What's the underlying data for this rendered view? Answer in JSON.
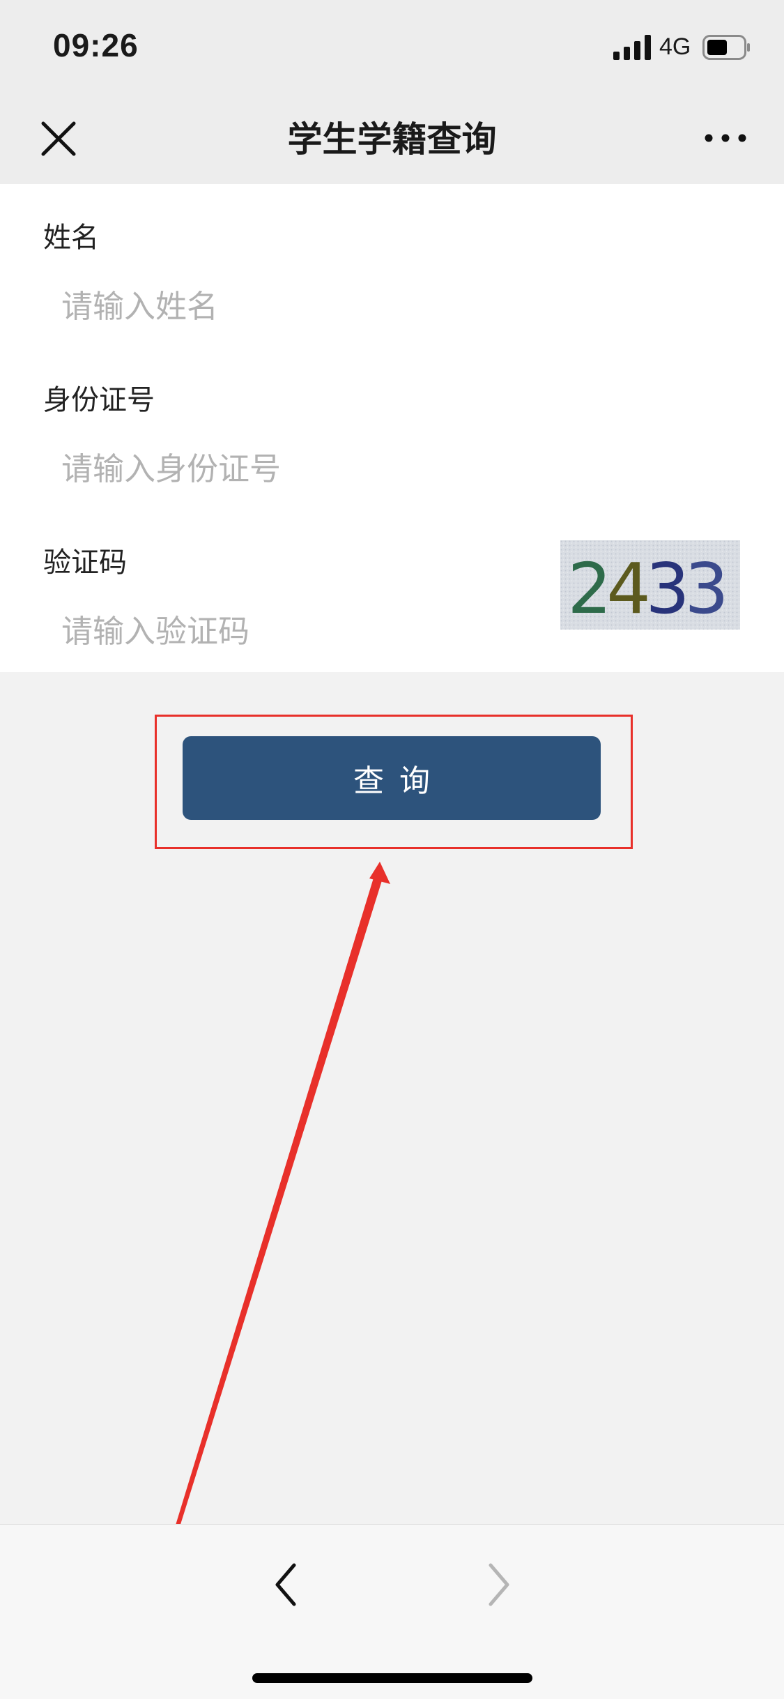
{
  "status_bar": {
    "time": "09:26",
    "network": "4G",
    "signal_icon": "signal-bars-icon",
    "battery_icon": "battery-icon",
    "battery_level": 0.55
  },
  "nav": {
    "title": "学生学籍查询",
    "close_icon": "close-icon",
    "more_icon": "more-dots-icon"
  },
  "form": {
    "name": {
      "label": "姓名",
      "placeholder": "请输入姓名",
      "value": ""
    },
    "id_number": {
      "label": "身份证号",
      "placeholder": "请输入身份证号",
      "value": ""
    },
    "captcha": {
      "label": "验证码",
      "placeholder": "请输入验证码",
      "value": "",
      "image_text": "2433",
      "digit_colors": [
        "#2e6b4a",
        "#5c5a1e",
        "#28337a",
        "#3b4a8c"
      ]
    },
    "submit_label": "查询"
  },
  "annotation": {
    "highlight_color": "#e8302a",
    "arrow_icon": "annotation-arrow-icon"
  },
  "toolbar": {
    "back_icon": "chevron-left-icon",
    "forward_icon": "chevron-right-icon"
  }
}
